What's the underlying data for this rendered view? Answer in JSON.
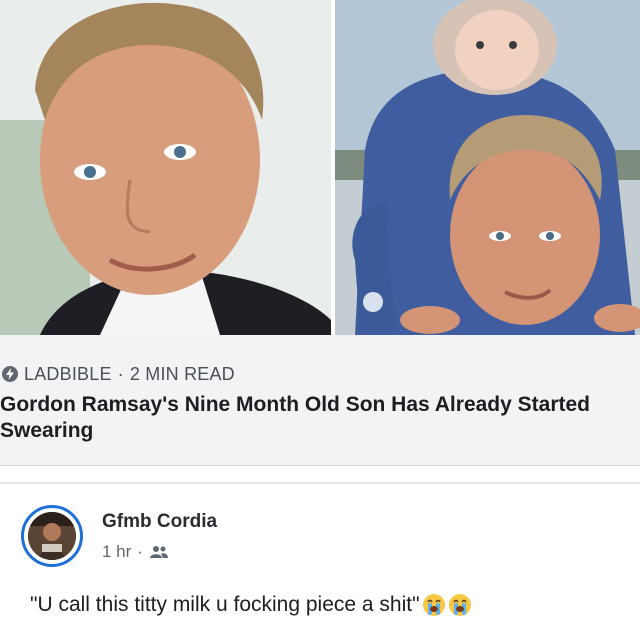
{
  "link_preview": {
    "source": "LADBIBLE",
    "separator": "·",
    "read_time": "2 MIN READ",
    "headline": "Gordon Ramsay's Nine Month Old Son Has Already Started Swearing"
  },
  "comment": {
    "author": "Gfmb Cordia",
    "time": "1 hr",
    "separator": "·",
    "audience_icon": "friends-icon",
    "text": "\"U call this titty milk u focking piece a shit\"",
    "emojis": [
      "loudly-crying-face-icon",
      "loudly-crying-face-icon"
    ]
  },
  "colors": {
    "avatar_ring": "#1e6fd9",
    "preview_bg": "#f2f3f5",
    "secondary_text": "#606770"
  }
}
